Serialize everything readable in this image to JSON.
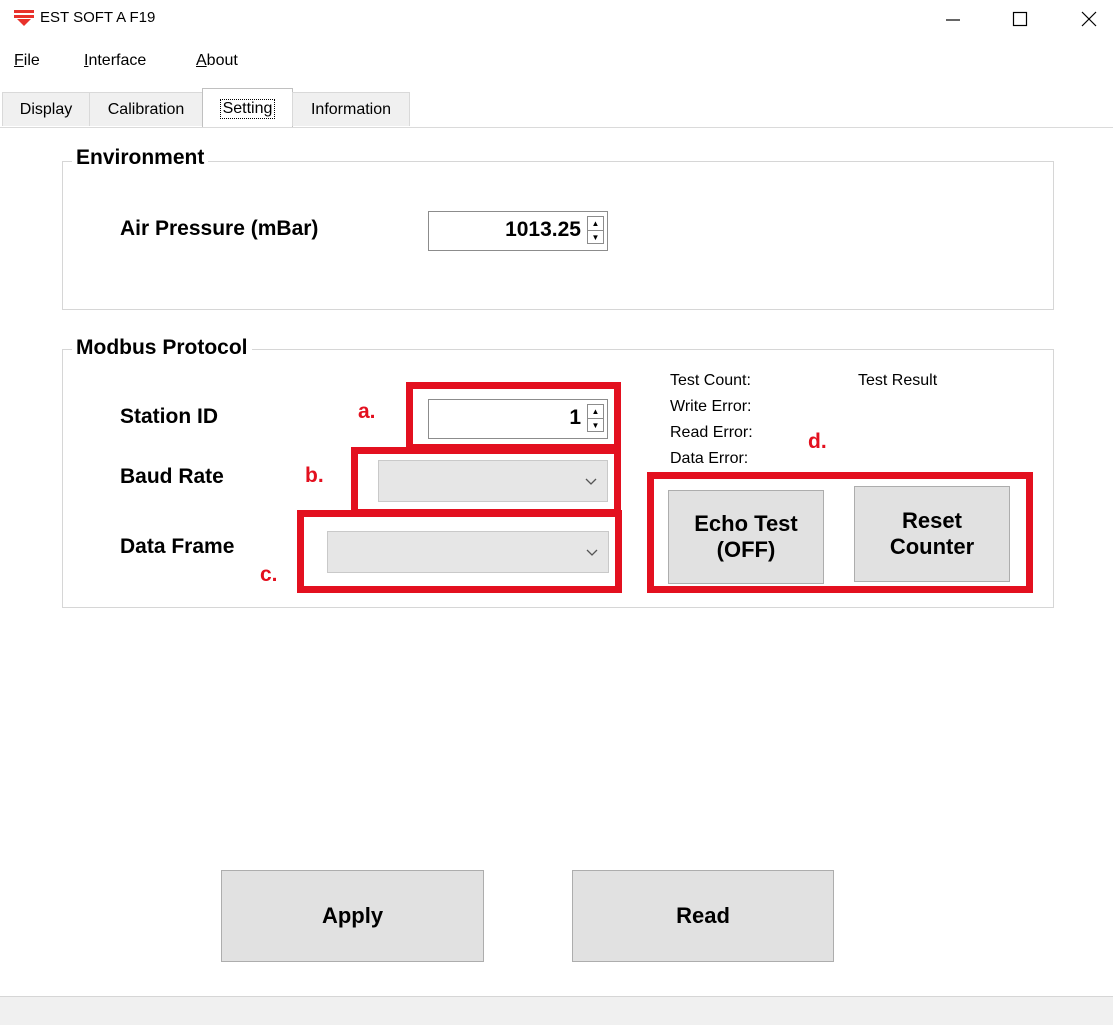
{
  "window": {
    "title": "EST SOFT A F19",
    "minimize_icon": "minimize-icon",
    "maximize_icon": "maximize-icon",
    "close_icon": "close-icon"
  },
  "menu": {
    "file": {
      "key": "F",
      "rest": "ile"
    },
    "interface": {
      "key": "I",
      "rest": "nterface"
    },
    "about": {
      "key": "A",
      "rest": "bout"
    }
  },
  "tabs": [
    {
      "label": "Display"
    },
    {
      "label": "Calibration"
    },
    {
      "label": "Setting"
    },
    {
      "label": "Information"
    }
  ],
  "environment": {
    "title": "Environment",
    "air_pressure_label": "Air Pressure (mBar)",
    "air_pressure_value": "1013.25"
  },
  "modbus": {
    "title": "Modbus Protocol",
    "station_id_label": "Station ID",
    "station_id_value": "1",
    "baud_rate_label": "Baud Rate",
    "baud_rate_value": "",
    "data_frame_label": "Data Frame",
    "data_frame_value": "",
    "test_count_label": "Test Count:",
    "test_result_label": "Test Result",
    "write_error_label": "Write Error:",
    "read_error_label": "Read Error:",
    "data_error_label": "Data Error:",
    "echo_test_button": "Echo Test\n(OFF)",
    "reset_counter_button": "Reset\nCounter"
  },
  "annotations": {
    "a": "a.",
    "b": "b.",
    "c": "c.",
    "d": "d."
  },
  "actions": {
    "apply": "Apply",
    "read": "Read"
  },
  "colors": {
    "annotation_red": "#e3101f",
    "logo_red": "#e8312b"
  }
}
